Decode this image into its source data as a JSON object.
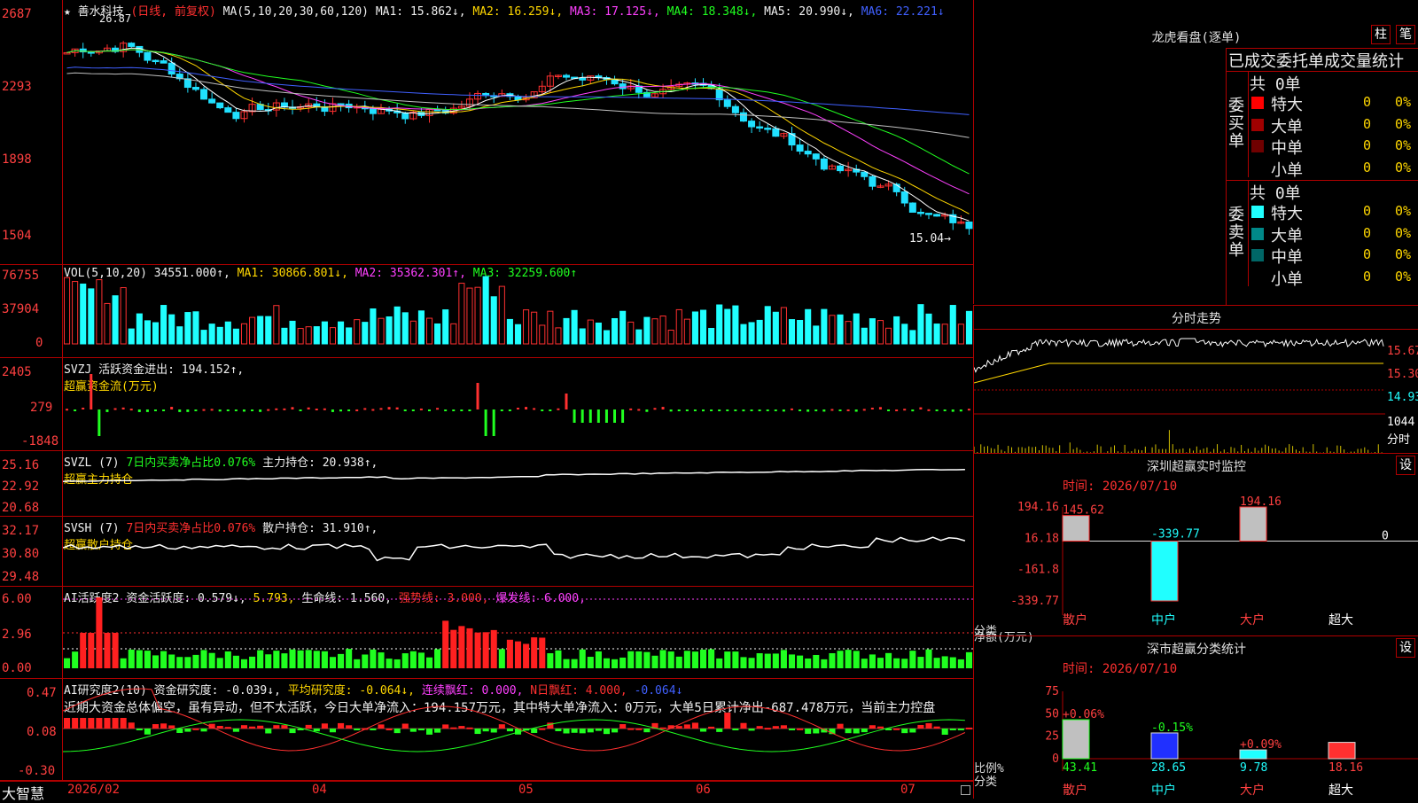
{
  "main": {
    "title": "★ 善水科技",
    "mode": "(日线, 前复权)",
    "ma_label": "MA(5,10,20,30,60,120)",
    "ma": [
      "MA1: 15.862↓,",
      "MA2: 16.259↓,",
      "MA3: 17.125↓,",
      "MA4: 18.348↓,",
      "MA5: 20.990↓,",
      "MA6: 22.221↓"
    ],
    "high_mark": "26.87",
    "low_mark": "15.04→",
    "yticks": [
      "2687",
      "2293",
      "1898",
      "1504"
    ],
    "colors": {
      "ma1": "#ffffff",
      "ma2": "#ffd700",
      "ma3": "#ff40ff",
      "ma4": "#20ff20",
      "ma5": "#c0c0c0",
      "ma6": "#4060ff",
      "up": "#ff3030",
      "down": "#20e0ff"
    }
  },
  "vol": {
    "label": "VOL(5,10,20)",
    "value": "34551.000↑,",
    "ma": [
      "MA1: 30866.801↓,",
      "MA2: 35362.301↑,",
      "MA3: 32259.600↑"
    ],
    "yticks": [
      "76755",
      "37904",
      "0"
    ]
  },
  "svzj": {
    "label": "SVZJ",
    "desc": "活跃资金进出: 194.152↑,",
    "sub": "超赢资金流(万元)",
    "yticks": [
      "2405",
      "279",
      "-1848"
    ]
  },
  "svzl": {
    "label": "SVZL (7)",
    "desc": "7日内买卖净占比0.076%",
    "hold": "主力持仓: 20.938↑,",
    "sub": "超赢主力持仓",
    "yticks": [
      "25.16",
      "22.92",
      "20.68"
    ]
  },
  "svsh": {
    "label": "SVSH (7)",
    "desc": "7日内买卖净占比0.076%",
    "hold": "散户持仓: 31.910↑,",
    "sub": "超赢散户持仓",
    "yticks": [
      "32.17",
      "30.80",
      "29.48"
    ]
  },
  "ai1": {
    "label": "AI活跃度2",
    "act": "资金活跃度: 0.579↓,",
    "v2": "5.793,",
    "life": "生命线: 1.560,",
    "strong": "强势线: 3.000,",
    "burst": "爆发线: 6.000,",
    "yticks": [
      "6.00",
      "2.96",
      "0.00"
    ]
  },
  "ai2": {
    "label": "AI研究度2(10)",
    "res": "资金研究度: -0.039↓,",
    "avg": "平均研究度: -0.064↓,",
    "cont": "连续飘红: 0.000,",
    "nday": "N日飘红: 4.000,",
    "last": "-0.064↓",
    "note": "近期大资金总体偏空，虽有异动，但不太活跃，今日大单净流入：194.157万元，其中特大单净流入：0万元，大单5日累计净出-687.478万元，当前主力控盘",
    "yticks": [
      "0.47",
      "0.08",
      "-0.30"
    ]
  },
  "xaxis": {
    "logo": "大智慧",
    "labels": [
      "2026/02",
      "04",
      "05",
      "06",
      "07"
    ]
  },
  "dragon": {
    "title": "龙虎看盘(逐单)",
    "btn1": "柱",
    "btn2": "笔",
    "header": "已成交委托单成交量统计",
    "buy_label": "委买单",
    "sell_label": "委卖单",
    "buy_total": "共 0单",
    "sell_total": "共 0单",
    "buy_rows": [
      {
        "name": "特大",
        "n": "0",
        "p": "0%",
        "color": "#ff0000"
      },
      {
        "name": "大单",
        "n": "0",
        "p": "0%",
        "color": "#a00000"
      },
      {
        "name": "中单",
        "n": "0",
        "p": "0%",
        "color": "#700000"
      },
      {
        "name": "小单",
        "n": "0",
        "p": "0%",
        "color": "#000000"
      }
    ],
    "sell_rows": [
      {
        "name": "特大",
        "n": "0",
        "p": "0%",
        "color": "#20ffff"
      },
      {
        "name": "大单",
        "n": "0",
        "p": "0%",
        "color": "#008888"
      },
      {
        "name": "中单",
        "n": "0",
        "p": "0%",
        "color": "#006666"
      },
      {
        "name": "小单",
        "n": "0",
        "p": "0%",
        "color": "#000000"
      }
    ]
  },
  "intraday": {
    "title": "分时走势",
    "yticks": [
      "15.67",
      "15.30",
      "14.93"
    ],
    "vol_label": "1044",
    "vol_unit": "分时"
  },
  "monitor": {
    "title": "深圳超赢实时监控",
    "btn": "设",
    "time": "时间: 2026/07/10",
    "yticks": [
      "194.16",
      "16.18",
      "-161.8",
      "-339.77"
    ],
    "ylabel": "净额(万元)",
    "xlabel": "分类",
    "chart_data": {
      "type": "bar",
      "categories": [
        "散户",
        "中户",
        "大户",
        "超大"
      ],
      "values": [
        145.62,
        -339.77,
        194.16,
        0
      ],
      "labels": [
        "145.62",
        "-339.77",
        "194.16",
        "0"
      ],
      "ylim": [
        -339.77,
        194.16
      ]
    }
  },
  "classify": {
    "title": "深市超赢分类统计",
    "btn": "设",
    "time": "时间: 2026/07/10",
    "yticks": [
      "75",
      "50",
      "25",
      "0"
    ],
    "ylabel": "比例%",
    "xlabel": "分类",
    "chart_data": {
      "type": "bar",
      "categories": [
        "散户",
        "中户",
        "大户",
        "超大"
      ],
      "values": [
        43.41,
        28.65,
        9.78,
        18.16
      ],
      "changes": [
        "+0.06%",
        "-0.15%",
        "+0.09%",
        ""
      ],
      "labels": [
        "43.41",
        "28.65",
        "9.78",
        "18.16"
      ],
      "ylim": [
        0,
        75
      ]
    }
  }
}
